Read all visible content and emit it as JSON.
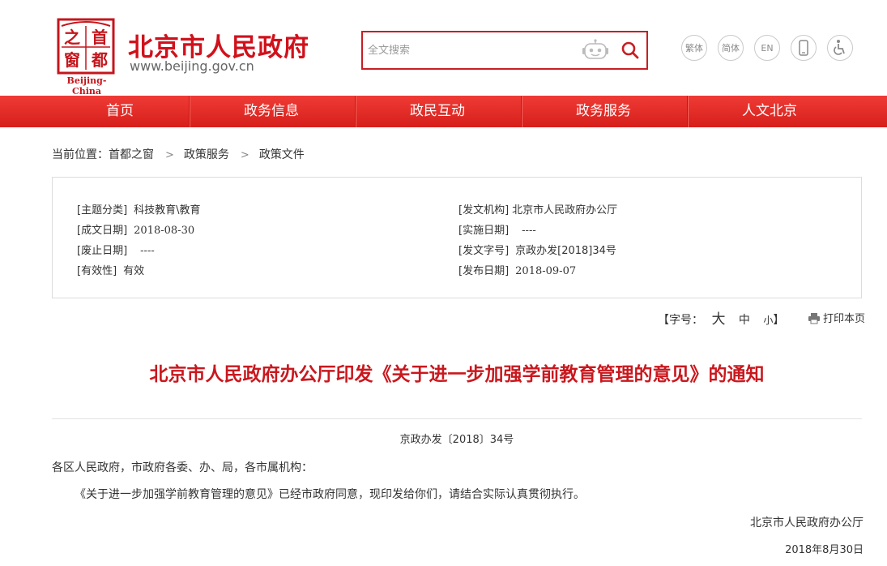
{
  "header": {
    "logo_chars": [
      "之",
      "首",
      "窗",
      "都"
    ],
    "logo_caption": "Beijing-China",
    "site_name": "北京市人民政府",
    "site_url": "www.beijing.gov.cn",
    "search_placeholder": "全文搜索",
    "tools": [
      {
        "label": "繁体"
      },
      {
        "label": "简体"
      },
      {
        "label": "EN"
      },
      {
        "icon": "mobile-icon"
      },
      {
        "icon": "accessibility-icon"
      }
    ]
  },
  "nav": [
    "首页",
    "政务信息",
    "政民互动",
    "政务服务",
    "人文北京"
  ],
  "breadcrumb": {
    "prefix": "当前位置：",
    "items": [
      "首都之窗",
      "政策服务",
      "政策文件"
    ],
    "separator": ">"
  },
  "meta": {
    "left": [
      {
        "label": "[主题分类]",
        "value": "科技教育\\教育"
      },
      {
        "label": "[成文日期]",
        "value": "2018-08-30"
      },
      {
        "label": "[废止日期]",
        "value": "----"
      },
      {
        "label": "[有效性]",
        "value": "有效"
      }
    ],
    "right": [
      {
        "label": "[发文机构]",
        "value": "北京市人民政府办公厅"
      },
      {
        "label": "[实施日期]",
        "value": "----"
      },
      {
        "label": "[发文字号]",
        "value": "京政办发[2018]34号"
      },
      {
        "label": "[发布日期]",
        "value": "2018-09-07"
      }
    ]
  },
  "font_size": {
    "label": "【字号：",
    "big": "大",
    "mid": "中",
    "small": "小",
    "close": "】"
  },
  "print_label": "打印本页",
  "article": {
    "title": "北京市人民政府办公厅印发《关于进一步加强学前教育管理的意见》的通知",
    "doc_number": "京政办发〔2018〕34号",
    "salutation": "各区人民政府，市政府各委、办、局，各市属机构：",
    "body": "《关于进一步加强学前教育管理的意见》已经市政府同意，现印发给你们，请结合实际认真贯彻执行。",
    "signature": "北京市人民政府办公厅",
    "date": "2018年8月30日"
  },
  "colors": {
    "brand_red": "#d0111b",
    "nav_red": "#e42b26",
    "title_red": "#c9181e"
  }
}
